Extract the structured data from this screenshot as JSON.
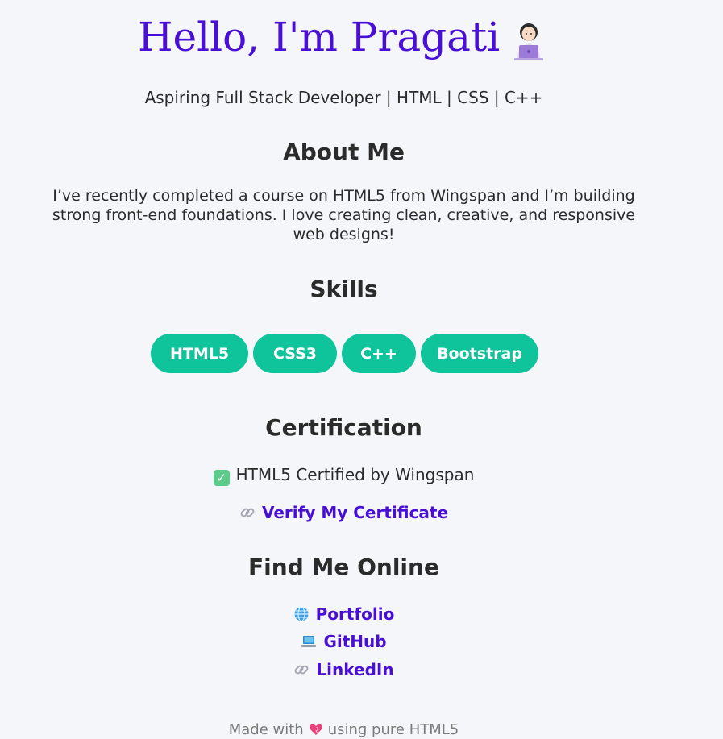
{
  "header": {
    "title": "Hello, I'm Pragati",
    "title_icon": "woman-technologist-icon",
    "subtitle": "Aspiring Full Stack Developer | HTML | CSS | C++"
  },
  "about": {
    "heading": "About Me",
    "text": "I’ve recently completed a course on HTML5 from Wingspan and I’m building strong front-end foundations. I love creating clean, creative, and responsive web designs!"
  },
  "skills": {
    "heading": "Skills",
    "items": [
      "HTML5",
      "CSS3",
      "C++",
      "Bootstrap"
    ]
  },
  "certification": {
    "heading": "Certification",
    "status_icon": "check-mark-icon",
    "text": "HTML5 Certified by Wingspan",
    "link_icon": "link-icon",
    "link_label": "Verify My Certificate"
  },
  "online": {
    "heading": "Find Me Online",
    "links": [
      {
        "icon": "globe-icon",
        "label": "Portfolio"
      },
      {
        "icon": "laptop-icon",
        "label": "GitHub"
      },
      {
        "icon": "link-icon",
        "label": "LinkedIn"
      }
    ]
  },
  "footer": {
    "before": "Made with",
    "icon": "heart-icon",
    "after": "using pure HTML5"
  },
  "colors": {
    "accent": "#4a0fd6",
    "pill": "#0fc39a",
    "background": "#f5f6fa"
  }
}
